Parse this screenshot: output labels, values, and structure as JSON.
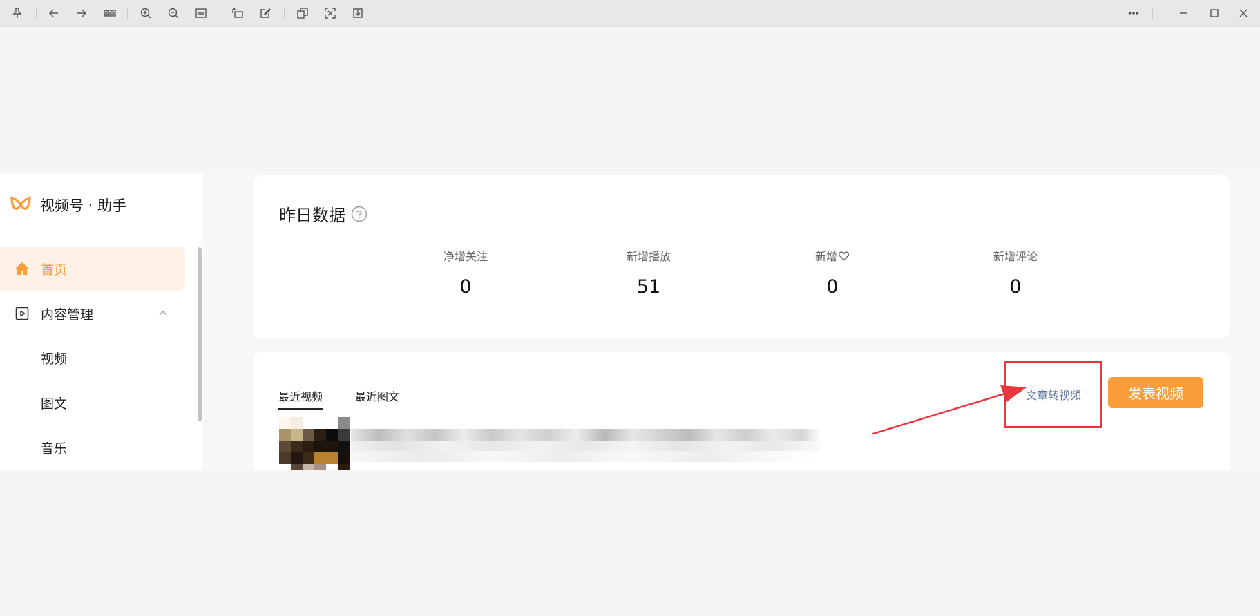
{
  "toolbar": {
    "icons": [
      "pin-icon",
      "back-icon",
      "forward-icon",
      "grid-icon",
      "zoom-in-icon",
      "zoom-out-icon",
      "fit-icon",
      "rotate-icon",
      "edit-icon",
      "copy-icon",
      "crop-icon",
      "save-icon",
      "more-icon",
      "minimize-icon",
      "maximize-icon",
      "close-icon"
    ]
  },
  "app": {
    "brand": {
      "name": "视频号 · 助手",
      "logo_color": "#fa9d3b"
    },
    "sidebar": {
      "items": [
        {
          "label": "首页",
          "icon": "home-icon",
          "active": true
        },
        {
          "label": "内容管理",
          "icon": "play-square-icon",
          "expanded": true
        }
      ],
      "sub_items": [
        "视频",
        "图文",
        "音乐"
      ]
    },
    "stats": {
      "title": "昨日数据",
      "metrics": [
        {
          "label": "净增关注",
          "value": "0"
        },
        {
          "label": "新增播放",
          "value": "51"
        },
        {
          "label": "新增",
          "icon": "heart-icon",
          "value": "0"
        },
        {
          "label": "新增评论",
          "value": "0"
        }
      ]
    },
    "recent": {
      "tabs": [
        {
          "label": "最近视频",
          "active": true
        },
        {
          "label": "最近图文",
          "active": false
        }
      ],
      "convert_link": "文章转视频",
      "publish_button": "发表视频"
    }
  },
  "colors": {
    "accent": "#fa9d3b",
    "annotation": "#e8363f",
    "link": "#5a6fa0"
  }
}
